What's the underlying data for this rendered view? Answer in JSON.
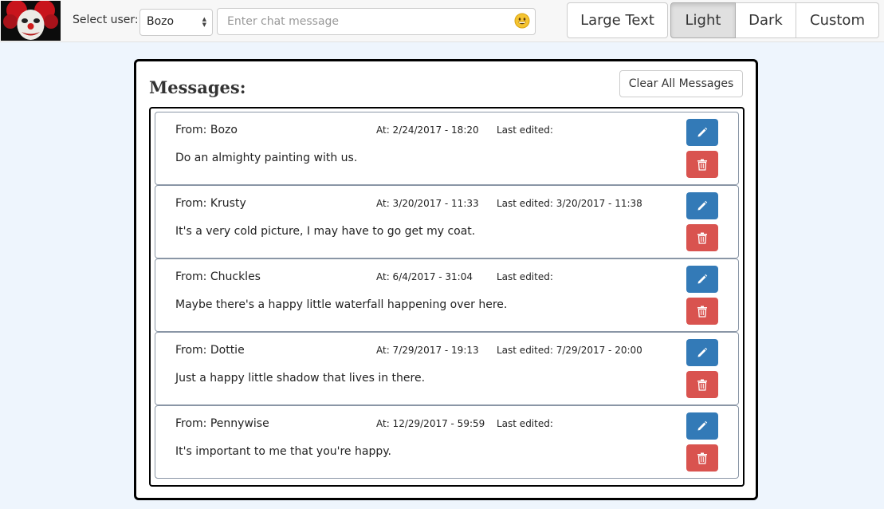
{
  "header": {
    "select_label": "Select user:",
    "selected_user": "Bozo",
    "chat_placeholder": "Enter chat message",
    "emoji_icon": "smiley-emoji-icon"
  },
  "theme_buttons": {
    "large_text": "Large Text",
    "light": "Light",
    "dark": "Dark",
    "custom": "Custom",
    "active": "Light"
  },
  "panel": {
    "title": "Messages:",
    "clear_label": "Clear All Messages"
  },
  "colors": {
    "edit": "#337ab7",
    "delete": "#d9534f",
    "background": "#eef5fd"
  },
  "messages": [
    {
      "from": "From: Bozo",
      "at": "At: 2/24/2017 - 18:20",
      "edited": "Last edited:",
      "text": "Do an almighty painting with us."
    },
    {
      "from": "From: Krusty",
      "at": "At: 3/20/2017 - 11:33",
      "edited": "Last edited: 3/20/2017 - 11:38",
      "text": "It's a very cold picture, I may have to go get my coat."
    },
    {
      "from": "From: Chuckles",
      "at": "At: 6/4/2017 - 31:04",
      "edited": "Last edited:",
      "text": "Maybe there's a happy little waterfall happening over here."
    },
    {
      "from": "From: Dottie",
      "at": "At: 7/29/2017 - 19:13",
      "edited": "Last edited: 7/29/2017 - 20:00",
      "text": "Just a happy little shadow that lives in there."
    },
    {
      "from": "From: Pennywise",
      "at": "At: 12/29/2017 - 59:59",
      "edited": "Last edited:",
      "text": "It's important to me that you're happy."
    }
  ]
}
